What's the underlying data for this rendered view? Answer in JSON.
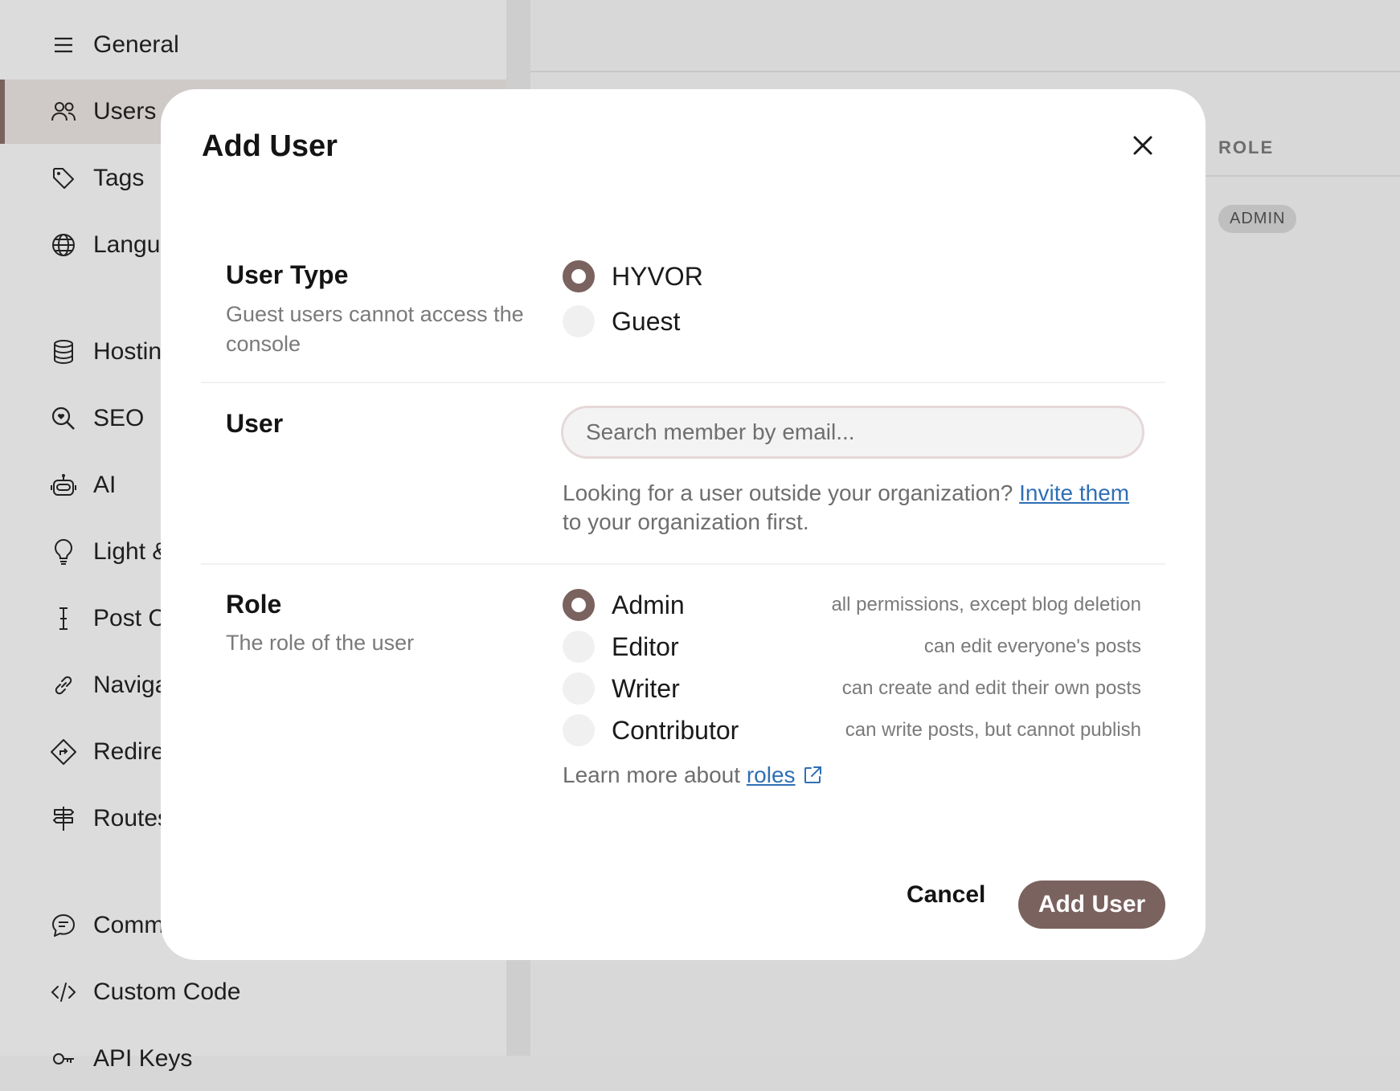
{
  "sidebar": {
    "items": [
      {
        "label": "General",
        "icon": "menu-icon"
      },
      {
        "label": "Users",
        "icon": "users-icon"
      },
      {
        "label": "Tags",
        "icon": "tag-icon"
      },
      {
        "label": "Langu",
        "icon": "globe-icon"
      },
      {
        "label": "Hostin",
        "icon": "database-icon"
      },
      {
        "label": "SEO",
        "icon": "search-heart-icon"
      },
      {
        "label": "AI",
        "icon": "robot-icon"
      },
      {
        "label": "Light &",
        "icon": "bulb-icon"
      },
      {
        "label": "Post C",
        "icon": "cursor-text-icon"
      },
      {
        "label": "Naviga",
        "icon": "link-icon"
      },
      {
        "label": "Redire",
        "icon": "sign-turn-icon"
      },
      {
        "label": "Routes",
        "icon": "signpost-icon"
      },
      {
        "label": "Comm",
        "icon": "chat-icon"
      },
      {
        "label": "Custom Code",
        "icon": "code-icon"
      },
      {
        "label": "API Keys",
        "icon": "key-icon"
      }
    ]
  },
  "main": {
    "role_header": "ROLE",
    "role_badge": "ADMIN"
  },
  "modal": {
    "title": "Add User",
    "user_type": {
      "title": "User Type",
      "description": "Guest users cannot access the console",
      "options": [
        "HYVOR",
        "Guest"
      ],
      "selected": "HYVOR"
    },
    "user": {
      "title": "User",
      "search_placeholder": "Search member by email...",
      "note_prefix": "Looking for a user outside your organization?",
      "note_link": "Invite them",
      "note_suffix": "to your organization first."
    },
    "role": {
      "title": "Role",
      "description": "The role of the user",
      "options": [
        {
          "label": "Admin",
          "hint": "all permissions, except blog deletion"
        },
        {
          "label": "Editor",
          "hint": "can edit everyone's posts"
        },
        {
          "label": "Writer",
          "hint": "can create and edit their own posts"
        },
        {
          "label": "Contributor",
          "hint": "can write posts, but cannot publish"
        }
      ],
      "selected": "Admin",
      "learn_prefix": "Learn more about",
      "learn_link": "roles"
    },
    "cancel_label": "Cancel",
    "submit_label": "Add User"
  },
  "colors": {
    "accent": "#7a625e",
    "link": "#2f6fb5"
  }
}
